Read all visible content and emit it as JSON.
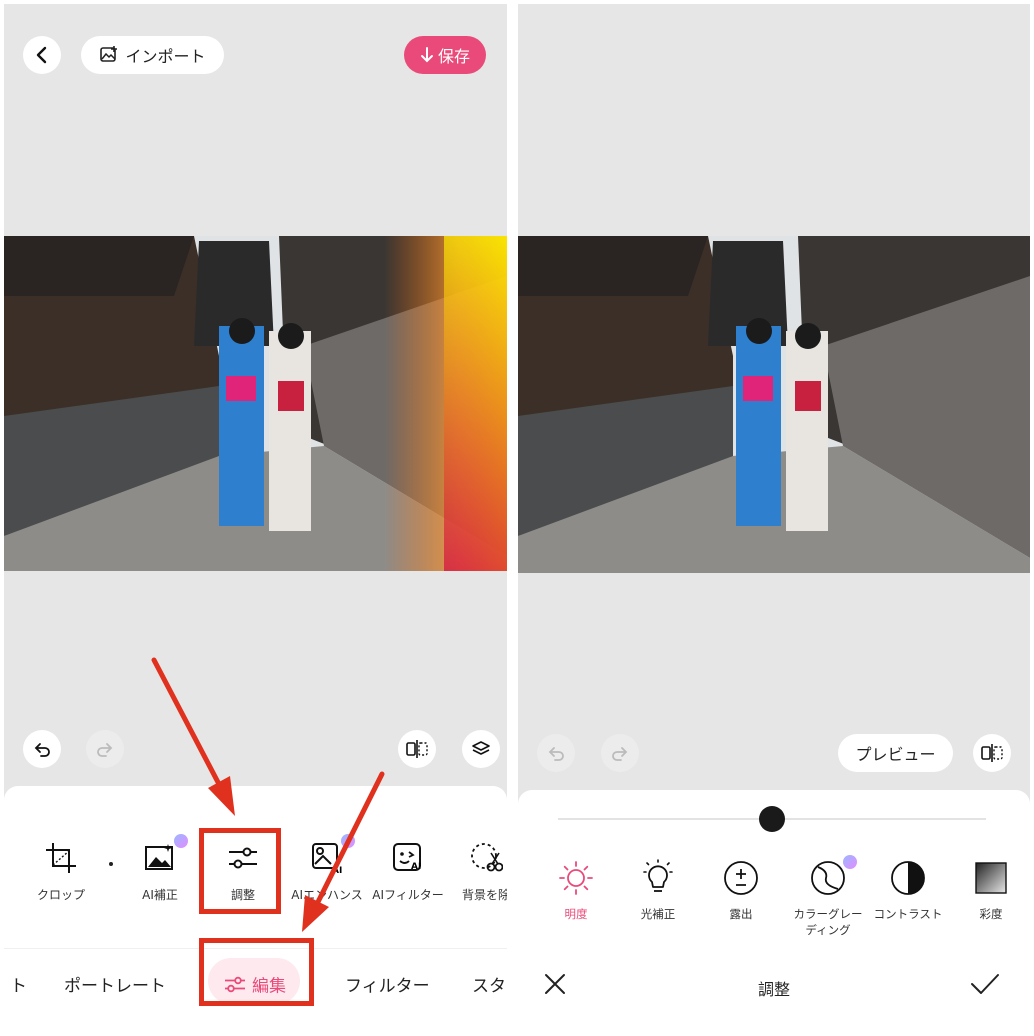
{
  "left": {
    "import_label": "インポート",
    "save_label": "保存",
    "tools": [
      {
        "label": "クロップ",
        "icon": "crop-icon"
      },
      {
        "label": "AI補正",
        "icon": "ai-enhance-image-icon"
      },
      {
        "label": "調整",
        "icon": "sliders-icon"
      },
      {
        "label": "AIエンハンス",
        "icon": "ai-enhance-icon"
      },
      {
        "label": "AIフィルター",
        "icon": "ai-filter-icon"
      },
      {
        "label": "背景を除",
        "icon": "background-remove-icon"
      }
    ],
    "tabs": [
      "ト",
      "ポートレート",
      "編集",
      "フィルター",
      "スタ"
    ],
    "active_tab": "編集"
  },
  "right": {
    "preview_label": "プレビュー",
    "slider_value": 0.5,
    "adjustments": [
      {
        "label": "明度",
        "icon": "sun-icon",
        "active": true
      },
      {
        "label": "光補正",
        "icon": "lightbulb-icon",
        "active": false
      },
      {
        "label": "露出",
        "icon": "exposure-icon",
        "active": false
      },
      {
        "label": "カラーグレーディング",
        "icon": "color-grading-icon",
        "active": false
      },
      {
        "label": "コントラスト",
        "icon": "contrast-icon",
        "active": false
      },
      {
        "label": "彩度",
        "icon": "saturation-icon",
        "active": false
      }
    ],
    "title": "調整"
  },
  "colors": {
    "accent": "#ea4a7a",
    "highlight_box": "#e0301e",
    "canvas_bg": "#e6e6e6"
  }
}
